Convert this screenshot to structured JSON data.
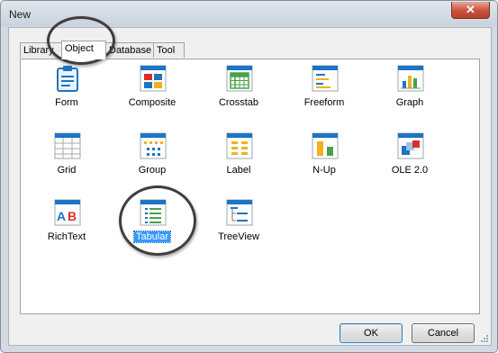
{
  "window": {
    "title": "New",
    "close_symbol": "✕"
  },
  "tabs": [
    {
      "label": "Library",
      "active": false
    },
    {
      "label": "Object",
      "active": true
    },
    {
      "label": "Database",
      "active": false
    },
    {
      "label": "Tool",
      "active": false
    }
  ],
  "items": [
    {
      "label": "Form",
      "icon": "form-icon",
      "selected": false
    },
    {
      "label": "Composite",
      "icon": "composite-icon",
      "selected": false
    },
    {
      "label": "Crosstab",
      "icon": "crosstab-icon",
      "selected": false
    },
    {
      "label": "Freeform",
      "icon": "freeform-icon",
      "selected": false
    },
    {
      "label": "Graph",
      "icon": "graph-icon",
      "selected": false
    },
    {
      "label": "Grid",
      "icon": "grid-icon",
      "selected": false
    },
    {
      "label": "Group",
      "icon": "group-icon",
      "selected": false
    },
    {
      "label": "Label",
      "icon": "label-icon",
      "selected": false
    },
    {
      "label": "N-Up",
      "icon": "n-up-icon",
      "selected": false
    },
    {
      "label": "OLE 2.0",
      "icon": "ole-icon",
      "selected": false
    },
    {
      "label": "RichText",
      "icon": "richtext-icon",
      "selected": false
    },
    {
      "label": "Tabular",
      "icon": "tabular-icon",
      "selected": true
    },
    {
      "label": "TreeView",
      "icon": "treeview-icon",
      "selected": false
    }
  ],
  "richtext_glyphs": {
    "a": "A",
    "b": "B"
  },
  "buttons": {
    "ok": "OK",
    "cancel": "Cancel"
  },
  "colors": {
    "accent_blue": "#1c74c4",
    "selection": "#3399ff",
    "close_red": "#c8513b"
  }
}
